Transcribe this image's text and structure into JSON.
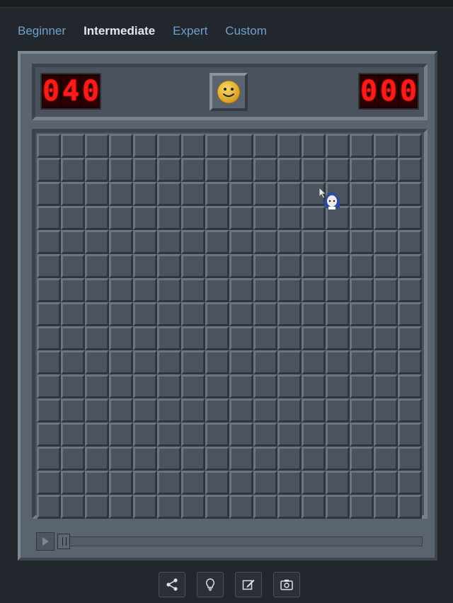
{
  "difficulty_tabs": [
    {
      "label": "Beginner",
      "active": false
    },
    {
      "label": "Intermediate",
      "active": true
    },
    {
      "label": "Expert",
      "active": false
    },
    {
      "label": "Custom",
      "active": false
    }
  ],
  "mine_counter": {
    "digits": [
      "0",
      "4",
      "0"
    ],
    "value": 40
  },
  "timer": {
    "digits": [
      "0",
      "0",
      "0"
    ],
    "value": 0
  },
  "face": {
    "state": "smile-icon"
  },
  "board": {
    "rows": 16,
    "cols": 16,
    "all_cells_covered": true
  },
  "replay": {
    "progress": 0
  },
  "toolbar": {
    "icons": [
      "share-icon",
      "hint-bulb-icon",
      "edit-icon",
      "screenshot-icon"
    ]
  },
  "colors": {
    "background": "#22272e",
    "tab_link": "#6fa0cf",
    "lcd_digit": "#ff1a1a",
    "cell": "#4b545e",
    "face": "#e8b93a"
  }
}
